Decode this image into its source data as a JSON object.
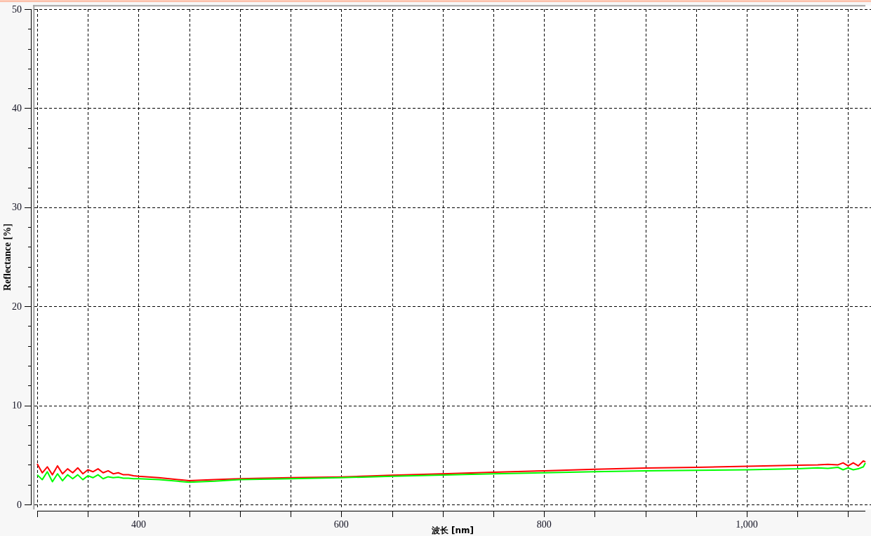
{
  "chart": {
    "chart_data": {
      "type": "line",
      "xlabel": "波长 [nm]",
      "ylabel": "Reflectance [%]",
      "grid": true,
      "x": [
        300,
        305,
        310,
        315,
        320,
        325,
        330,
        335,
        340,
        345,
        350,
        355,
        360,
        365,
        370,
        375,
        380,
        385,
        390,
        395,
        400,
        420,
        450,
        475,
        500,
        550,
        600,
        650,
        700,
        750,
        800,
        850,
        900,
        950,
        1000,
        1050,
        1070,
        1080,
        1090,
        1095,
        1100,
        1105,
        1110,
        1115,
        1117
      ],
      "series": [
        {
          "color": "#ff0000",
          "values": [
            4.1,
            3.2,
            3.8,
            3.0,
            3.9,
            3.1,
            3.6,
            3.2,
            3.7,
            3.1,
            3.5,
            3.3,
            3.6,
            3.2,
            3.4,
            3.1,
            3.2,
            3.0,
            3.0,
            2.9,
            2.85,
            2.7,
            2.4,
            2.5,
            2.6,
            2.7,
            2.78,
            2.95,
            3.1,
            3.25,
            3.4,
            3.55,
            3.68,
            3.75,
            3.85,
            3.95,
            4.0,
            4.05,
            4.0,
            4.2,
            3.9,
            4.2,
            3.9,
            4.4,
            4.3
          ]
        },
        {
          "color": "#00ff00",
          "values": [
            3.0,
            2.5,
            3.3,
            2.3,
            3.1,
            2.4,
            3.0,
            2.6,
            3.0,
            2.5,
            2.9,
            2.7,
            3.0,
            2.6,
            2.8,
            2.7,
            2.75,
            2.65,
            2.65,
            2.6,
            2.6,
            2.5,
            2.25,
            2.35,
            2.5,
            2.6,
            2.7,
            2.85,
            2.98,
            3.1,
            3.2,
            3.3,
            3.4,
            3.45,
            3.5,
            3.6,
            3.7,
            3.65,
            3.75,
            3.5,
            3.7,
            3.5,
            3.6,
            3.8,
            4.2
          ]
        }
      ],
      "xlim": [
        300,
        1117
      ],
      "ylim": [
        0,
        50
      ],
      "xticks": [
        400,
        600,
        800,
        {
          "value": 1000,
          "label": "1,000"
        }
      ],
      "yticks": [
        0,
        10,
        20,
        30,
        40,
        50
      ]
    }
  }
}
